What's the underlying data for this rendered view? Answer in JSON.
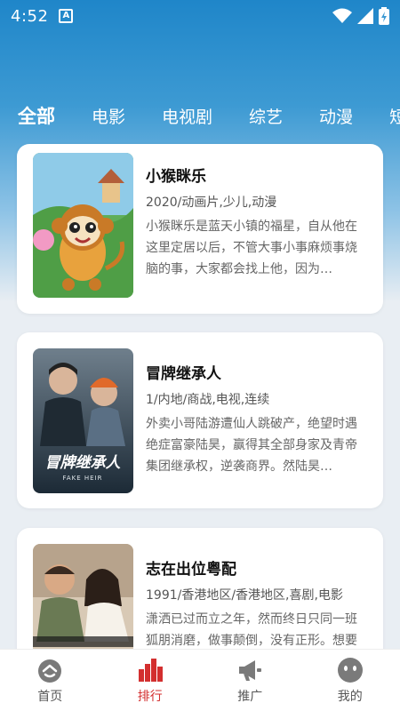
{
  "status": {
    "time": "4:52",
    "sim_label": "A"
  },
  "tabs": [
    {
      "label": "全部",
      "active": true
    },
    {
      "label": "电影",
      "active": false
    },
    {
      "label": "电视剧",
      "active": false
    },
    {
      "label": "综艺",
      "active": false
    },
    {
      "label": "动漫",
      "active": false
    },
    {
      "label": "短",
      "active": false
    }
  ],
  "cards": [
    {
      "title": "小猴眯乐",
      "meta": "2020/动画片,少儿,动漫",
      "desc": "小猴眯乐是蓝天小镇的福星，自从他在这里定居以后，不管大事小事麻烦事烧脑的事，大家都会找上他，因为…"
    },
    {
      "title": "冒牌继承人",
      "meta": "1/内地/商战,电视,连续",
      "desc": "外卖小哥陆游遭仙人跳破产，绝望时遇绝症富豪陆昊，赢得其全部身家及青帝集团继承权，逆袭商界。然陆昊…",
      "poster_text": "冒牌继承人",
      "poster_subtext": "FAKE HEIR"
    },
    {
      "title": "志在出位粤配",
      "meta": "1991/香港地区/香港地区,喜剧,电影",
      "desc": "潇洒已过而立之年，然而终日只同一班狐朋消磨，做事颠倒，没有正形。想要拜入都派太哥门下却被对方打驳…"
    }
  ],
  "nav": [
    {
      "label": "首页",
      "icon": "home-icon",
      "active": false
    },
    {
      "label": "排行",
      "icon": "ranking-icon",
      "active": true
    },
    {
      "label": "推广",
      "icon": "megaphone-icon",
      "active": false
    },
    {
      "label": "我的",
      "icon": "profile-icon",
      "active": false
    }
  ],
  "colors": {
    "accent": "#d32f2f",
    "header": "#1f86c9"
  }
}
